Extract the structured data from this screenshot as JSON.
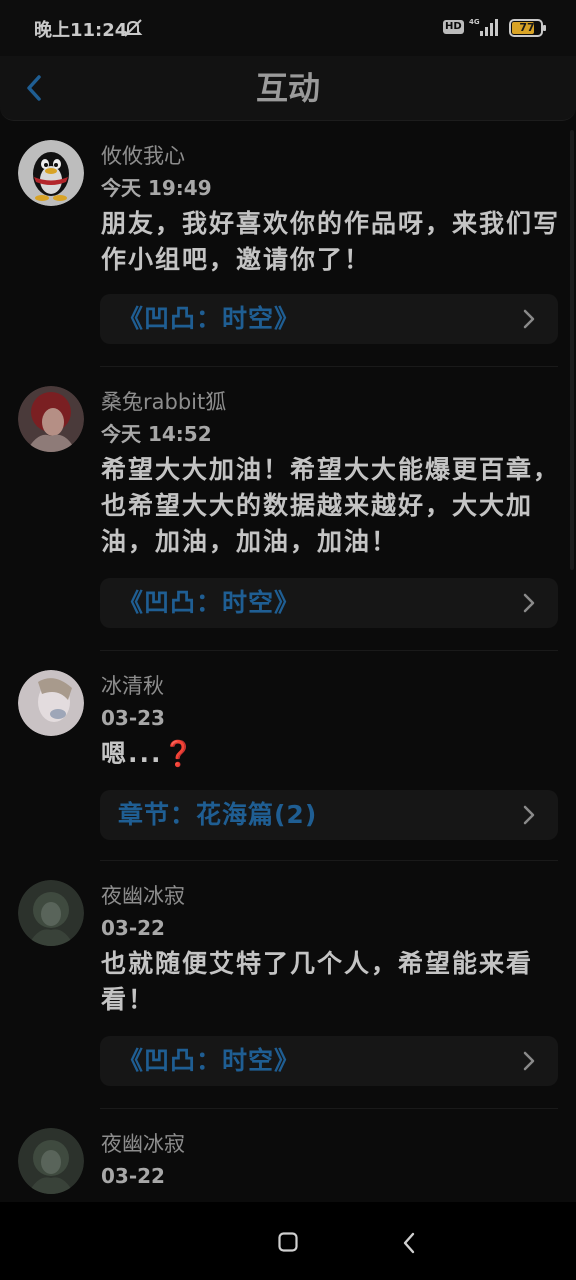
{
  "status_bar": {
    "time": "晚上11:24",
    "hd": "HD",
    "battery": "77"
  },
  "header": {
    "title": "互动"
  },
  "items": [
    {
      "username": "攸攸我心",
      "date": "今天 19:49",
      "message": "朋友，我好喜欢你的作品呀，来我们写作小组吧，邀请你了！",
      "link": "《凹凸：时空》"
    },
    {
      "username": "桑兔rabbit狐",
      "date": "今天 14:52",
      "message": "希望大大加油！希望大大能爆更百章，也希望大大的数据越来越好，大大加油，加油，加油，加油！",
      "link": "《凹凸：时空》"
    },
    {
      "username": "冰清秋",
      "date": "03-23",
      "message": "嗯...",
      "message_emoji": "❓",
      "link": "章节：花海篇(2)"
    },
    {
      "username": "夜幽冰寂",
      "date": "03-22",
      "message": "也就随便艾特了几个人，希望能来看看！",
      "link": "《凹凸：时空》"
    },
    {
      "username": "夜幽冰寂",
      "date": "03-22"
    }
  ],
  "colors": {
    "background": "#0b0b0b",
    "link": "#1f5e93",
    "accent_back": "#1f5e93"
  }
}
